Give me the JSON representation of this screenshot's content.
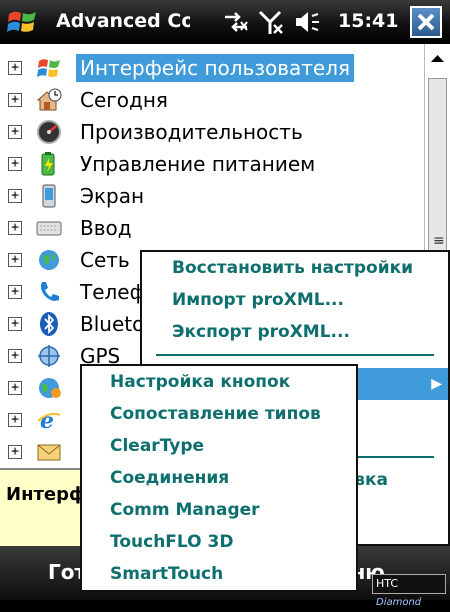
{
  "app": {
    "title": "Advanced Configuration",
    "time": "15:41"
  },
  "tree": {
    "items": [
      {
        "label": "Интерфейс пользователя",
        "icon": "windows-flag-icon",
        "selected": true
      },
      {
        "label": "Сегодня",
        "icon": "home-clock-icon"
      },
      {
        "label": "Производительность",
        "icon": "speedometer-icon"
      },
      {
        "label": "Управление питанием",
        "icon": "battery-icon"
      },
      {
        "label": "Экран",
        "icon": "phone-screen-icon"
      },
      {
        "label": "Ввод",
        "icon": "keyboard-icon"
      },
      {
        "label": "Сеть",
        "icon": "globe-network-icon"
      },
      {
        "label": "Телефон",
        "icon": "phone-handset-icon"
      },
      {
        "label": "Bluetooth",
        "icon": "bluetooth-icon"
      },
      {
        "label": "GPS",
        "icon": "gps-satellite-icon"
      },
      {
        "label": "",
        "icon": "globe-icon"
      },
      {
        "label": "",
        "icon": "internet-explorer-icon"
      },
      {
        "label": "",
        "icon": "envelope-icon"
      }
    ]
  },
  "description": {
    "text": "Интерфейс пользователя"
  },
  "softkeys": {
    "left": "Готово",
    "right": "Меню"
  },
  "branding": {
    "brand": "HTC",
    "model": "Diamond"
  },
  "menu": {
    "items": [
      "Восстановить настройки",
      "Импорт proXML...",
      "Экспорт proXML...",
      "",
      "",
      "",
      "",
      "Справка"
    ]
  },
  "submenu": {
    "items": [
      "Настройка кнопок",
      "Сопоставление типов",
      "ClearType",
      "Соединения",
      "Comm Manager",
      "TouchFLO 3D",
      "SmartTouch"
    ]
  },
  "colors": {
    "accent": "#3f9bd9",
    "menu_text": "#0f6e6e",
    "description_bg": "#ffffc8"
  }
}
